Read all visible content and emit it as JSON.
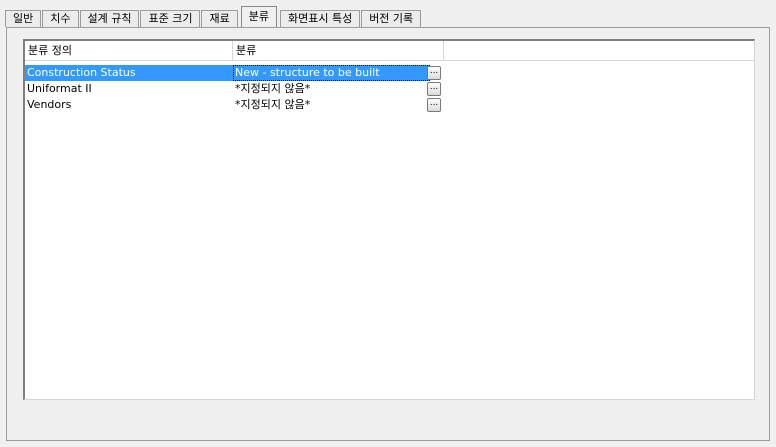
{
  "tabs": [
    {
      "label": "일반"
    },
    {
      "label": "치수"
    },
    {
      "label": "설계 규칙"
    },
    {
      "label": "표준 크기"
    },
    {
      "label": "재료"
    },
    {
      "label": "분류",
      "active": true
    },
    {
      "label": "화면표시 특성"
    },
    {
      "label": "버전 기록"
    }
  ],
  "grid": {
    "columns": [
      "분류 정의",
      "분류",
      ""
    ],
    "rows": [
      {
        "name": "Construction Status",
        "value": "New - structure to be built",
        "button": "...",
        "selected": true
      },
      {
        "name": "Uniformat II",
        "value": "*지정되지 않음*",
        "button": "..."
      },
      {
        "name": "Vendors",
        "value": "*지정되지 않음*",
        "button": "..."
      }
    ]
  },
  "colors": {
    "selection": "#3399ff",
    "background": "#f0f0f0"
  }
}
